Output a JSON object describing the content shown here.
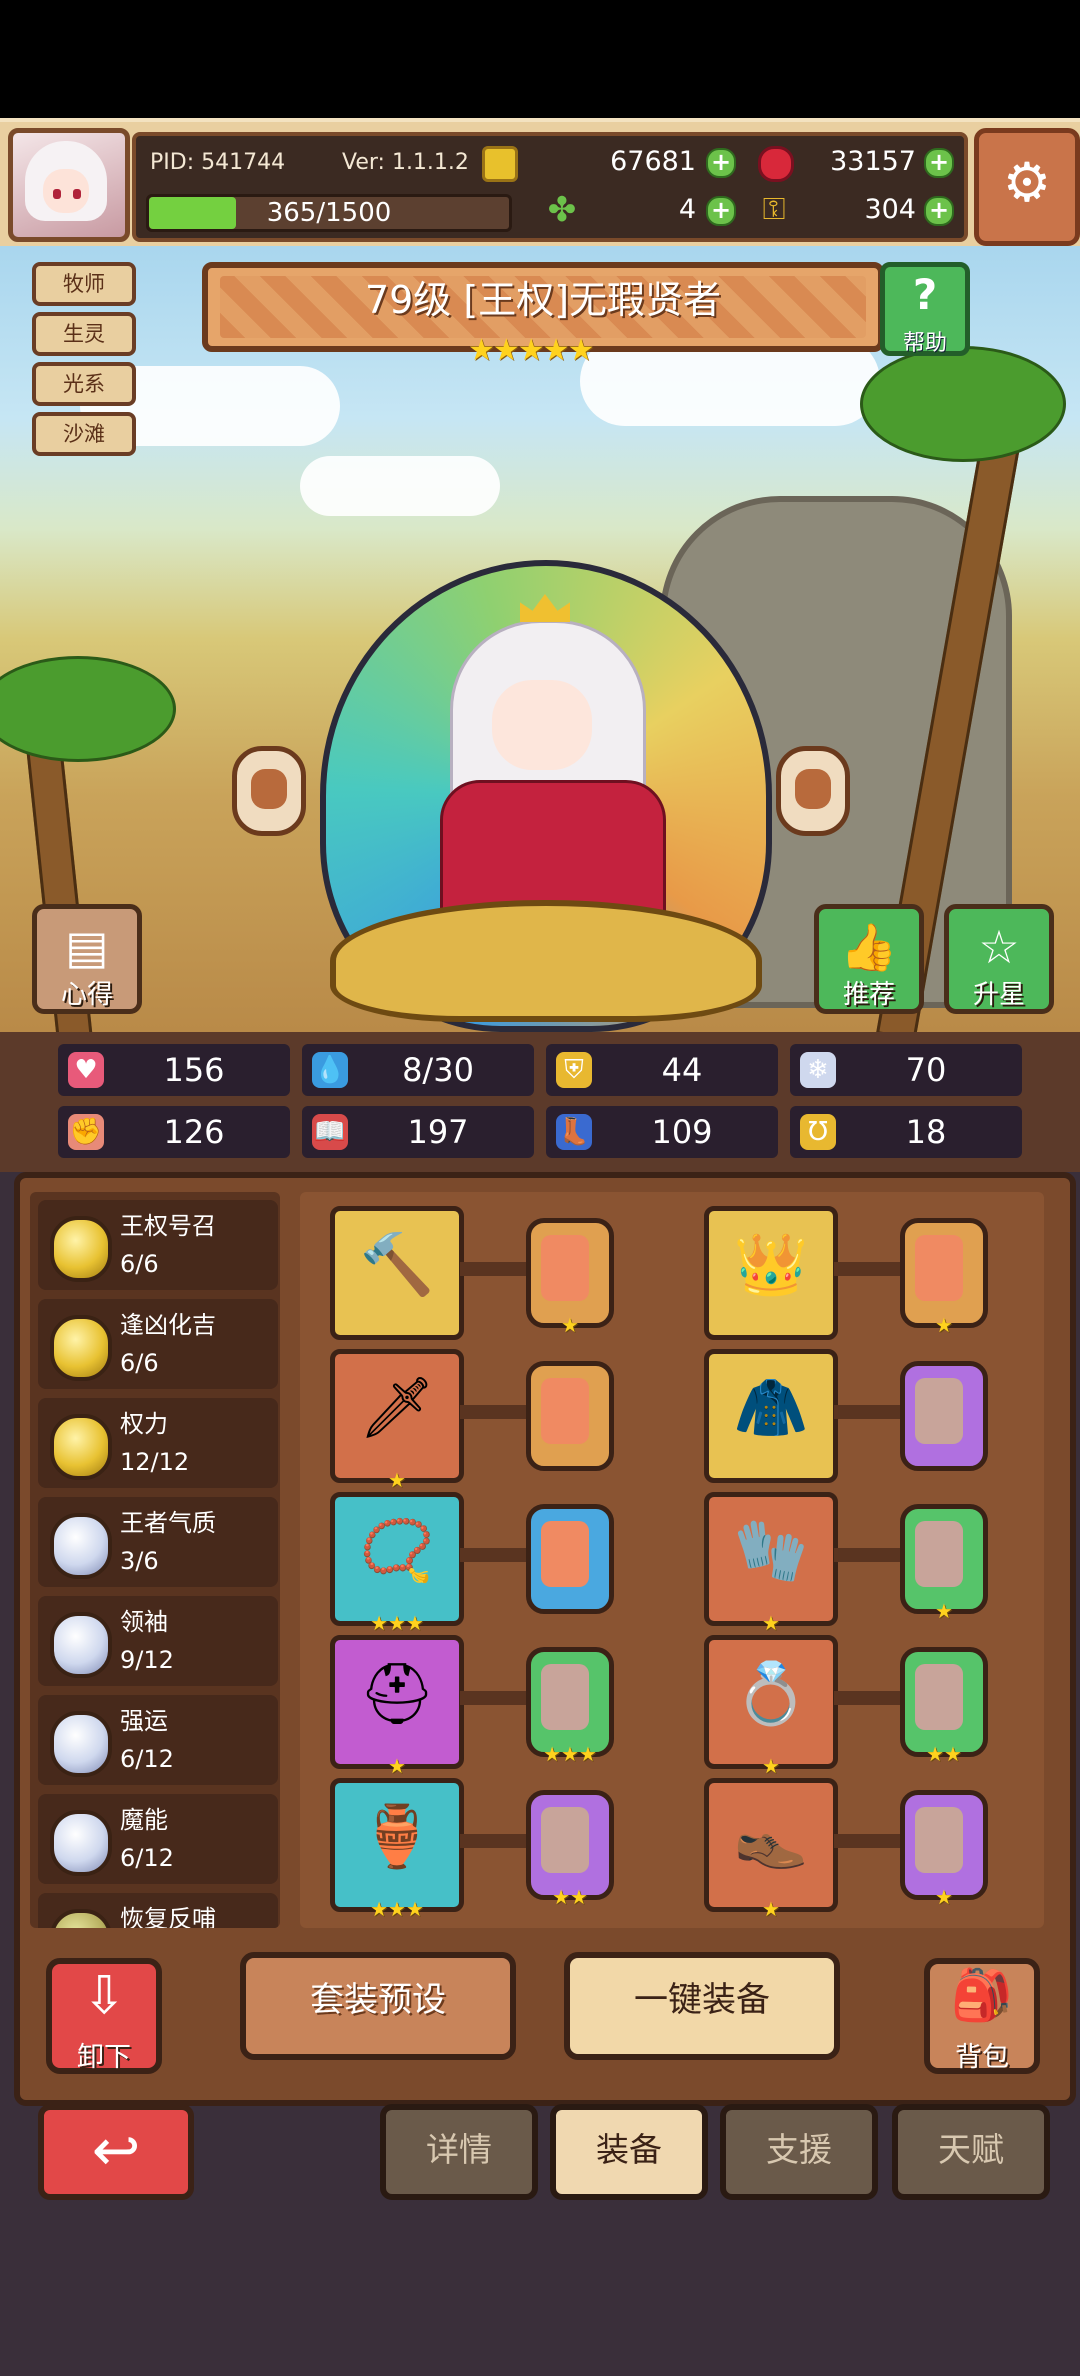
{
  "header": {
    "pid": "PID: 541744",
    "version": "Ver: 1.1.1.2",
    "gold": "67681",
    "ruby": "33157",
    "clover": "4",
    "keys": "304",
    "energy_text": "365/1500",
    "energy_fraction": 0.243,
    "plus": "+",
    "settings_icon": "gear-icon"
  },
  "hero": {
    "tags": [
      "牧师",
      "生灵",
      "光系",
      "沙滩"
    ],
    "title": "79级  [王权]无瑕贤者",
    "stars": "★★★★★",
    "help_label": "帮助",
    "help_glyph": "?",
    "left_button_label": "心得",
    "recommend_label": "推荐",
    "star_up_label": "升星"
  },
  "stats": [
    {
      "icon": "heart-icon",
      "glyph": "♥",
      "color": "#e85a7a",
      "value": "156"
    },
    {
      "icon": "drop-icon",
      "glyph": "💧",
      "color": "#3a9be0",
      "value": "8/30"
    },
    {
      "icon": "shield-icon",
      "glyph": "⛨",
      "color": "#e8b830",
      "value": "44"
    },
    {
      "icon": "wing-icon",
      "glyph": "❄",
      "color": "#cfd8ee",
      "value": "70"
    },
    {
      "icon": "fist-icon",
      "glyph": "✊",
      "color": "#e88a78",
      "value": "126"
    },
    {
      "icon": "book-icon",
      "glyph": "📖",
      "color": "#d84a4a",
      "value": "197"
    },
    {
      "icon": "boot-icon",
      "glyph": "👢",
      "color": "#3a6ad0",
      "value": "109"
    },
    {
      "icon": "horseshoe-icon",
      "glyph": "Ʊ",
      "color": "#e8b830",
      "value": "18"
    }
  ],
  "sets": [
    {
      "name": "王权号召",
      "count": "6/6",
      "medal": "gold"
    },
    {
      "name": "逢凶化吉",
      "count": "6/6",
      "medal": "gold"
    },
    {
      "name": "权力",
      "count": "12/12",
      "medal": "gold"
    },
    {
      "name": "王者气质",
      "count": "3/6",
      "medal": "silver"
    },
    {
      "name": "领袖",
      "count": "9/12",
      "medal": "silver"
    },
    {
      "name": "强运",
      "count": "6/12",
      "medal": "silver"
    },
    {
      "name": "魔能",
      "count": "6/12",
      "medal": "silver"
    },
    {
      "name": "恢复反哺",
      "count": "",
      "medal": "olive"
    }
  ],
  "equipment": [
    {
      "slot": "scepter",
      "glyph": "🔨",
      "bg": "gold",
      "stars": "",
      "rune": "blue-rune",
      "rune_bg": "orange",
      "rune_stars": "★"
    },
    {
      "slot": "crown",
      "glyph": "👑",
      "bg": "gold",
      "stars": "",
      "rune": "orange-rune",
      "rune_bg": "orange",
      "rune_stars": "★"
    },
    {
      "slot": "sword",
      "glyph": "🗡",
      "bg": "orange",
      "stars": "★",
      "rune": "teal-rune",
      "rune_bg": "orange",
      "rune_stars": ""
    },
    {
      "slot": "robe",
      "glyph": "🧥",
      "bg": "gold",
      "stars": "",
      "rune": "purple-rune",
      "rune_bg": "purple",
      "rune_stars": ""
    },
    {
      "slot": "necklace",
      "glyph": "📿",
      "bg": "teal",
      "stars": "★★★",
      "rune": "blue-rune",
      "rune_bg": "blue",
      "rune_stars": ""
    },
    {
      "slot": "gloves",
      "glyph": "🧤",
      "bg": "orange",
      "stars": "★",
      "rune": "green-rune",
      "rune_bg": "green",
      "rune_stars": "★"
    },
    {
      "slot": "helmet",
      "glyph": "⛑",
      "bg": "purple",
      "stars": "★",
      "rune": "green-rune",
      "rune_bg": "green",
      "rune_stars": "★★★"
    },
    {
      "slot": "belt",
      "glyph": "💍",
      "bg": "orange",
      "stars": "★",
      "rune": "green-rune",
      "rune_bg": "green",
      "rune_stars": "★★"
    },
    {
      "slot": "vase",
      "glyph": "🏺",
      "bg": "teal",
      "stars": "★★★",
      "rune": "purple-rune",
      "rune_bg": "purple",
      "rune_stars": "★★"
    },
    {
      "slot": "boots",
      "glyph": "👞",
      "bg": "orange",
      "stars": "★",
      "rune": "purple-rune",
      "rune_bg": "purple",
      "rune_stars": "★"
    }
  ],
  "actions": {
    "unequip_label": "卸下",
    "preset_label": "套装预设",
    "one_click_label": "一键装备",
    "bag_label": "背包"
  },
  "nav": {
    "back_glyph": "↩",
    "tabs": [
      {
        "label": "详情",
        "active": false
      },
      {
        "label": "装备",
        "active": true
      },
      {
        "label": "支援",
        "active": false
      },
      {
        "label": "天赋",
        "active": false
      }
    ]
  }
}
